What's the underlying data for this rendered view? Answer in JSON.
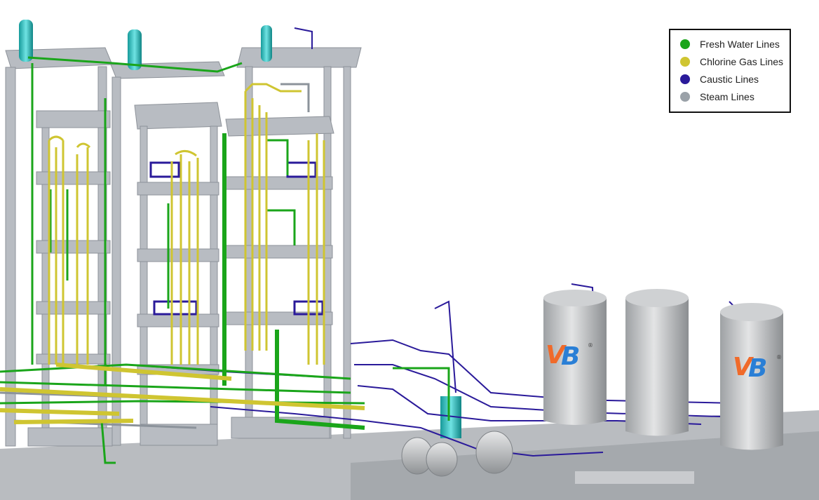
{
  "legend": {
    "items": [
      {
        "label": "Fresh Water Lines",
        "color": "#1aa51a"
      },
      {
        "label": "Chlorine Gas Lines",
        "color": "#cfc531"
      },
      {
        "label": "Caustic Lines",
        "color": "#2a1a9a"
      },
      {
        "label": "Steam Lines",
        "color": "#9aa1a8"
      }
    ]
  },
  "colors": {
    "structure": "#b8bcc2",
    "structure_dark": "#8d9299",
    "vessel": "#2ec9c9",
    "tank": "#c4c6c8",
    "logo_orange": "#f06a2a",
    "logo_blue": "#2a7fd6"
  },
  "logos": [
    {
      "text": "VB",
      "mark": "®"
    },
    {
      "text": "VB",
      "mark": "®"
    }
  ]
}
